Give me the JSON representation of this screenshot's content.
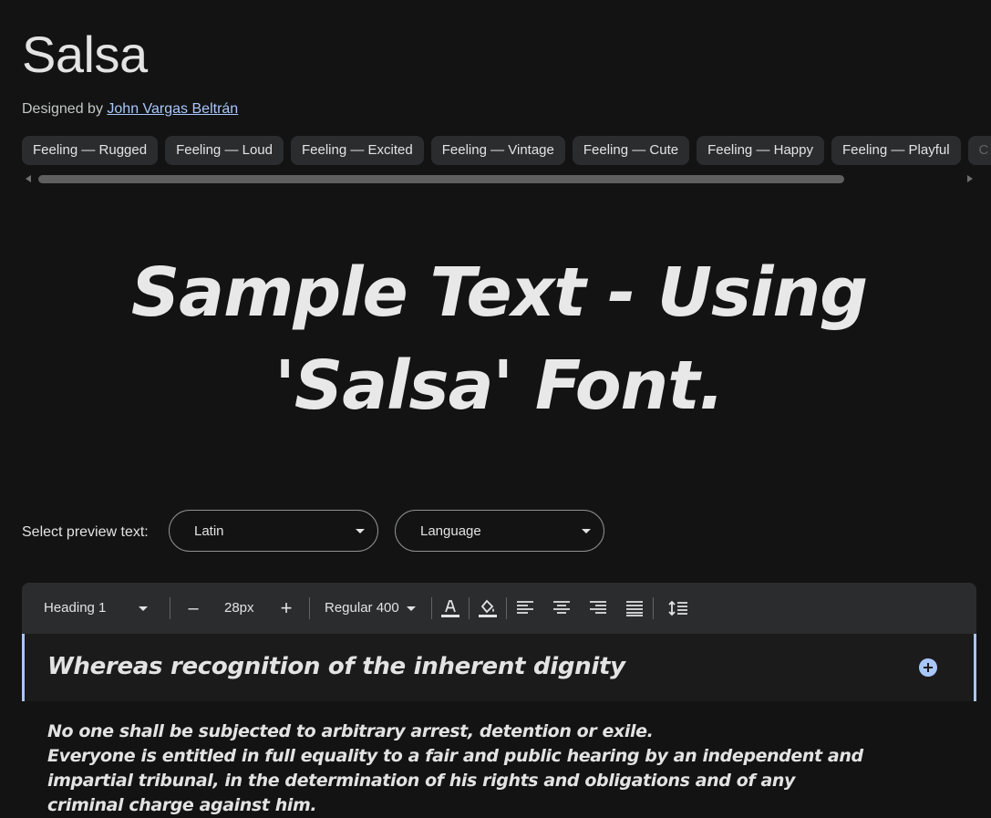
{
  "font": {
    "title": "Salsa",
    "designed_by_label": "Designed by",
    "designer_name": "John Vargas Beltrán"
  },
  "tags": [
    "Feeling — Rugged",
    "Feeling — Loud",
    "Feeling — Excited",
    "Feeling — Vintage",
    "Feeling — Cute",
    "Feeling — Happy",
    "Feeling — Playful",
    "C"
  ],
  "sample_text": "Sample Text - Using 'Salsa' Font.",
  "preview": {
    "label": "Select preview text:",
    "script_value": "Latin",
    "language_value": "Language"
  },
  "toolbar": {
    "style_value": "Heading 1",
    "decrease_label": "–",
    "size_value": "28px",
    "increase_label": "+",
    "weight_value": "Regular 400"
  },
  "editor": {
    "heading": "Whereas recognition of the inherent dignity",
    "paragraphs": [
      "No one shall be subjected to arbitrary arrest, detention or exile.",
      "Everyone is entitled in full equality to a fair and public hearing by an independent and impartial tribunal, in the determination of his rights and obligations and of any criminal charge against him."
    ]
  },
  "colors": {
    "background": "#131314",
    "chip": "#2b2c2e",
    "accent": "#a8c7fa",
    "text": "#e3e3e3"
  },
  "icons": [
    "text-color-icon",
    "highlight-icon",
    "align-left-icon",
    "align-center-icon",
    "align-right-icon",
    "align-justify-icon",
    "line-spacing-icon",
    "add-circle-icon",
    "chevron-down-icon"
  ]
}
